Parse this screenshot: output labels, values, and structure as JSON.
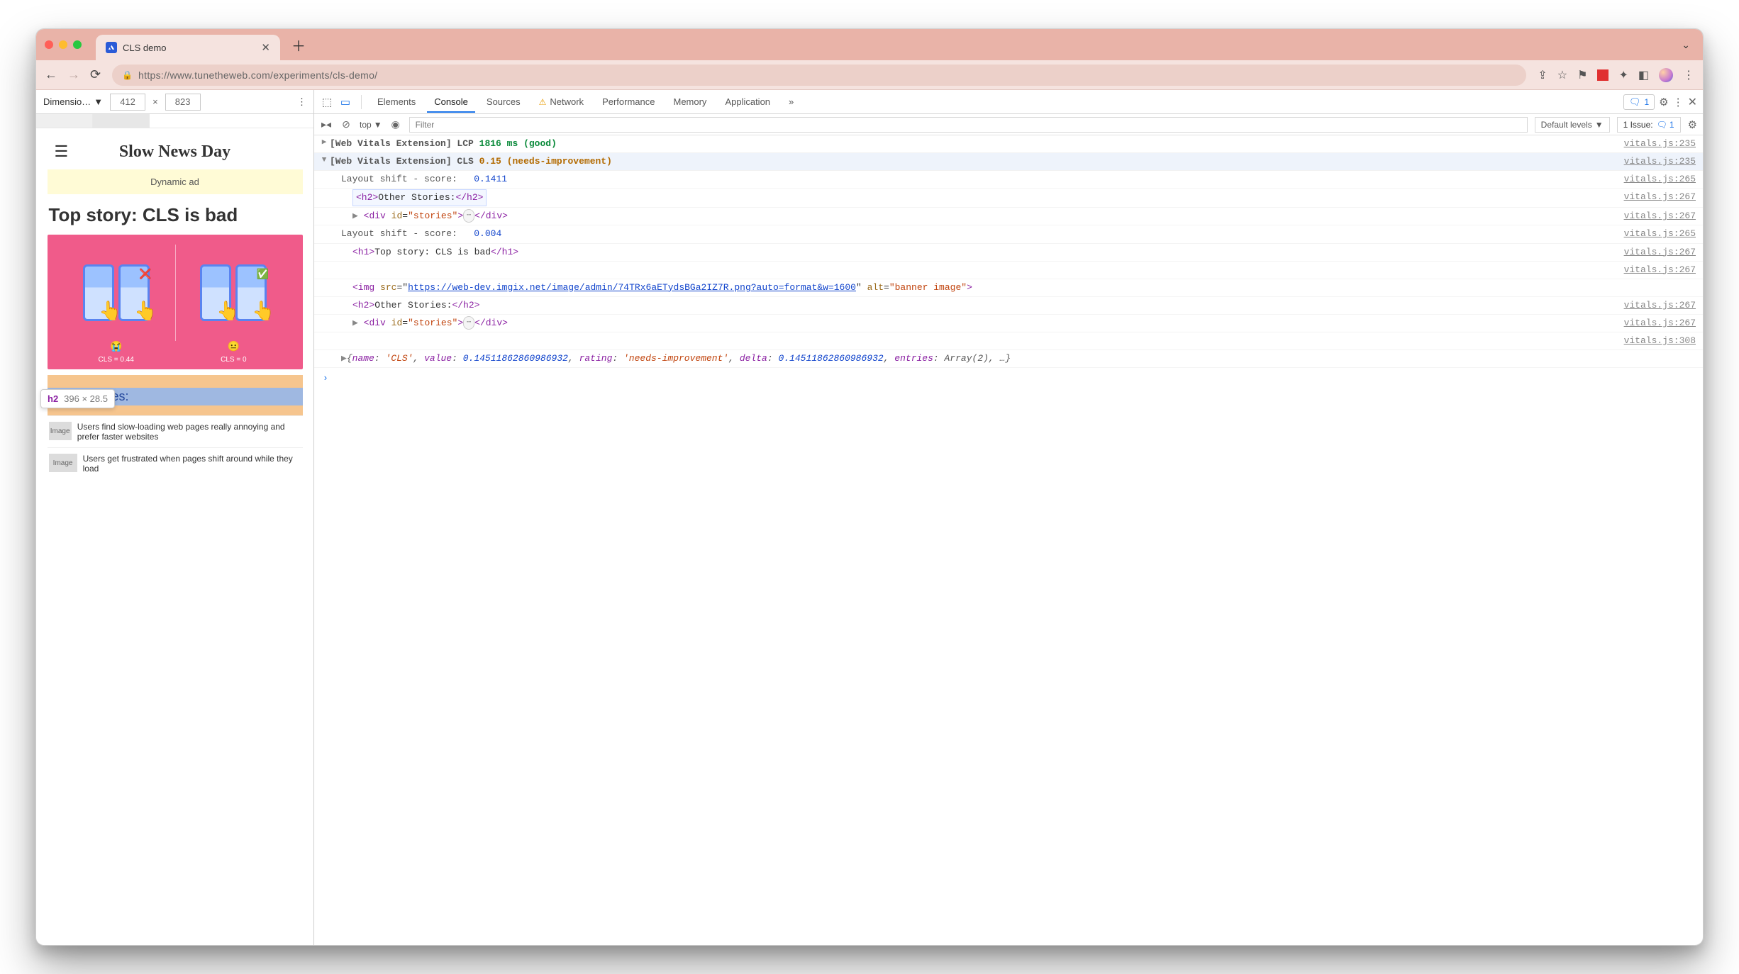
{
  "window": {
    "tab_title": "CLS demo",
    "url": "https://www.tunetheweb.com/experiments/cls-demo/"
  },
  "device_toolbar": {
    "label": "Dimensio…",
    "width": "412",
    "height": "823"
  },
  "page_preview": {
    "site_title": "Slow News Day",
    "ad_text": "Dynamic ad",
    "headline": "Top story: CLS is bad",
    "banner_left_caption": "CLS = 0.44",
    "banner_right_caption": "CLS = 0",
    "section_heading": "Other Stories:",
    "story1": "Users find slow-loading web pages really annoying and prefer faster websites",
    "story2": "Users get frustrated when pages shift around while they load",
    "thumb_label": "Image",
    "tooltip_tag": "h2",
    "tooltip_dims": "396 × 28.5"
  },
  "devtools": {
    "tabs": [
      "Elements",
      "Console",
      "Sources",
      "Network",
      "Performance",
      "Memory",
      "Application"
    ],
    "active_tab": "Console",
    "warn_tab": "Network",
    "badge_count": "1",
    "console_toolbar": {
      "context": "top",
      "filter_placeholder": "Filter",
      "levels": "Default levels",
      "issues_label": "1 Issue:",
      "issues_count": "1"
    },
    "rows": {
      "lcp": {
        "prefix": "[Web Vitals Extension] LCP",
        "value": "1816 ms",
        "rating": "(good)",
        "src": "vitals.js:235"
      },
      "cls_head": {
        "prefix": "[Web Vitals Extension] CLS",
        "value": "0.15",
        "rating": "(needs-improvement)",
        "src": "vitals.js:235"
      },
      "shift1_label": "Layout shift - score:",
      "shift1_value": "0.1411",
      "shift1_src": "vitals.js:265",
      "h2_line": "Other Stories:",
      "h2_src": "vitals.js:267",
      "stories_div_src": "vitals.js:267",
      "shift2_label": "Layout shift - score:",
      "shift2_value": "0.004",
      "shift2_src": "vitals.js:265",
      "h1_text": "Top story: CLS is bad",
      "h1_src": "vitals.js:267",
      "img_src_url": "https://web-dev.imgix.net/image/admin/74TRx6aETydsBGa2IZ7R.png?auto=format&w=1600",
      "img_alt": "banner image",
      "img_src": "vitals.js:267",
      "h2b_src": "vitals.js:267",
      "stories2_src": "vitals.js:267",
      "obj_src": "vitals.js:308",
      "obj_text": "{name: 'CLS', value: 0.14511862860986932, rating: 'needs-improvement', delta: 0.14511862860986932, entries: Array(2), …}"
    }
  }
}
